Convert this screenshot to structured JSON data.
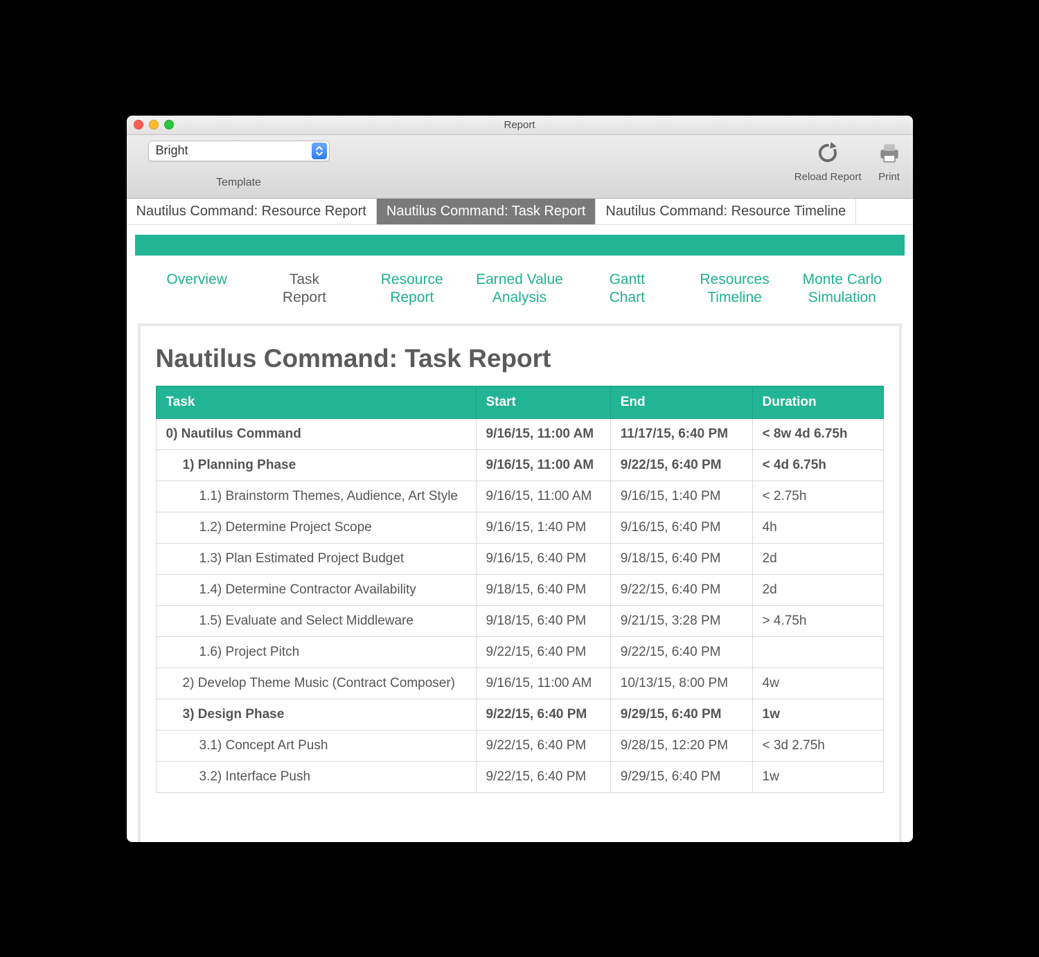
{
  "window": {
    "title": "Report"
  },
  "toolbar": {
    "template_value": "Bright",
    "template_label": "Template",
    "reload_label": "Reload Report",
    "print_label": "Print"
  },
  "report_tabs": [
    {
      "label": "Nautilus Command: Resource Report",
      "active": false
    },
    {
      "label": "Nautilus Command: Task Report",
      "active": true
    },
    {
      "label": "Nautilus Command: Resource Timeline",
      "active": false
    }
  ],
  "subnav": [
    {
      "label": "Overview",
      "active": false
    },
    {
      "label": "Task\nReport",
      "active": true
    },
    {
      "label": "Resource\nReport",
      "active": false
    },
    {
      "label": "Earned Value\nAnalysis",
      "active": false
    },
    {
      "label": "Gantt\nChart",
      "active": false
    },
    {
      "label": "Resources\nTimeline",
      "active": false
    },
    {
      "label": "Monte Carlo\nSimulation",
      "active": false
    }
  ],
  "report": {
    "title": "Nautilus Command: Task Report",
    "columns": [
      "Task",
      "Start",
      "End",
      "Duration"
    ]
  },
  "rows": [
    {
      "indent": 0,
      "bold": true,
      "task": "0) Nautilus Command",
      "start": "9/16/15, 11:00 AM",
      "end": "11/17/15, 6:40 PM",
      "duration": "< 8w 4d 6.75h"
    },
    {
      "indent": 1,
      "bold": true,
      "task": "1) Planning Phase",
      "start": "9/16/15, 11:00 AM",
      "end": "9/22/15, 6:40 PM",
      "duration": "< 4d 6.75h"
    },
    {
      "indent": 2,
      "bold": false,
      "task": "1.1) Brainstorm Themes, Audience, Art Style",
      "start": "9/16/15, 11:00 AM",
      "end": "9/16/15, 1:40 PM",
      "duration": "< 2.75h"
    },
    {
      "indent": 2,
      "bold": false,
      "task": "1.2) Determine Project Scope",
      "start": "9/16/15, 1:40 PM",
      "end": "9/16/15, 6:40 PM",
      "duration": "4h"
    },
    {
      "indent": 2,
      "bold": false,
      "task": "1.3) Plan Estimated Project Budget",
      "start": "9/16/15, 6:40 PM",
      "end": "9/18/15, 6:40 PM",
      "duration": "2d"
    },
    {
      "indent": 2,
      "bold": false,
      "task": "1.4) Determine Contractor Availability",
      "start": "9/18/15, 6:40 PM",
      "end": "9/22/15, 6:40 PM",
      "duration": "2d"
    },
    {
      "indent": 2,
      "bold": false,
      "task": "1.5) Evaluate and Select Middleware",
      "start": "9/18/15, 6:40 PM",
      "end": "9/21/15, 3:28 PM",
      "duration": "> 4.75h"
    },
    {
      "indent": 2,
      "bold": false,
      "task": "1.6) Project Pitch",
      "start": "9/22/15, 6:40 PM",
      "end": "9/22/15, 6:40 PM",
      "duration": ""
    },
    {
      "indent": 1,
      "bold": false,
      "task": "2) Develop Theme Music (Contract Composer)",
      "start": "9/16/15, 11:00 AM",
      "end": "10/13/15, 8:00 PM",
      "duration": "4w"
    },
    {
      "indent": 1,
      "bold": true,
      "task": "3) Design Phase",
      "start": "9/22/15, 6:40 PM",
      "end": "9/29/15, 6:40 PM",
      "duration": "1w"
    },
    {
      "indent": 2,
      "bold": false,
      "task": "3.1) Concept Art Push",
      "start": "9/22/15, 6:40 PM",
      "end": "9/28/15, 12:20 PM",
      "duration": "< 3d 2.75h"
    },
    {
      "indent": 2,
      "bold": false,
      "task": "3.2) Interface Push",
      "start": "9/22/15, 6:40 PM",
      "end": "9/29/15, 6:40 PM",
      "duration": "1w"
    }
  ]
}
